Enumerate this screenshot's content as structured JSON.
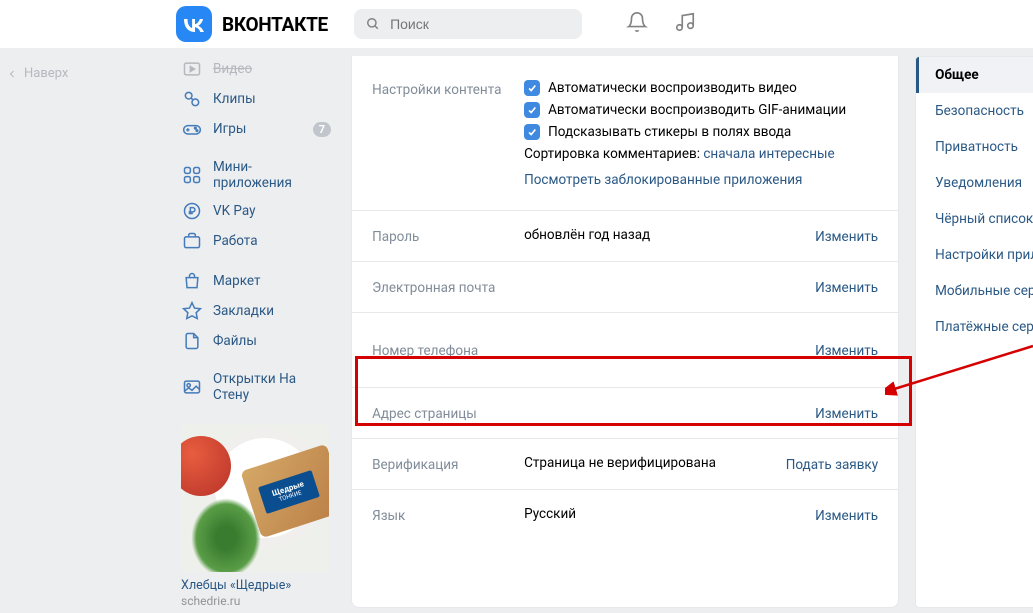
{
  "header": {
    "brand": "ВКОНТАКТЕ",
    "search_placeholder": "Поиск"
  },
  "back_top": "Наверх",
  "sidebar": {
    "items": [
      {
        "label": "Видео"
      },
      {
        "label": "Клипы"
      },
      {
        "label": "Игры",
        "badge": "7"
      },
      {
        "label": "Мини-приложения"
      },
      {
        "label": "VK Pay"
      },
      {
        "label": "Работа"
      },
      {
        "label": "Маркет"
      },
      {
        "label": "Закладки"
      },
      {
        "label": "Файлы"
      },
      {
        "label": "Открытки На Стену"
      }
    ]
  },
  "ad": {
    "title": "Хлебцы «Щедрые»",
    "domain": "schedrie.ru",
    "label_big": "Щедрые",
    "label_small": "ТОНКИЕ"
  },
  "settings": {
    "content": {
      "label": "Настройки контента",
      "chk1": "Автоматически воспроизводить видео",
      "chk2": "Автоматически воспроизводить GIF-анимации",
      "chk3": "Подсказывать стикеры в полях ввода",
      "sort_label": "Сортировка комментариев:",
      "sort_value": "сначала интересные",
      "blocked_link": "Посмотреть заблокированные приложения"
    },
    "password": {
      "label": "Пароль",
      "value": "обновлён год назад",
      "action": "Изменить"
    },
    "email": {
      "label": "Электронная почта",
      "action": "Изменить"
    },
    "phone": {
      "label": "Номер телефона",
      "action": "Изменить"
    },
    "address": {
      "label": "Адрес страницы",
      "action": "Изменить"
    },
    "verify": {
      "label": "Верификация",
      "value": "Страница не верифицирована",
      "action": "Подать заявку"
    },
    "lang": {
      "label": "Язык",
      "value": "Русский",
      "action": "Изменить"
    }
  },
  "right_menu": {
    "items": [
      "Общее",
      "Безопасность",
      "Приватность",
      "Уведомления",
      "Чёрный список",
      "Настройки приложений",
      "Мобильные сервисы",
      "Платёжные сервисы"
    ]
  }
}
